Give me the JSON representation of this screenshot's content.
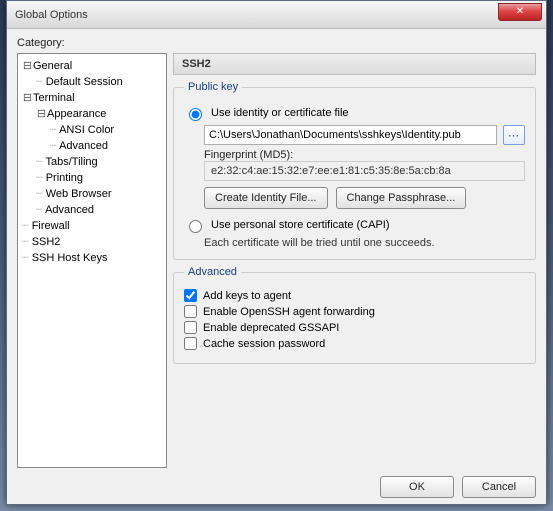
{
  "window": {
    "title": "Global Options"
  },
  "category_label": "Category:",
  "tree": {
    "general": "General",
    "default_session": "Default Session",
    "terminal": "Terminal",
    "appearance": "Appearance",
    "ansi_color": "ANSI Color",
    "advanced_appearance": "Advanced",
    "tabs_tiling": "Tabs/Tiling",
    "printing": "Printing",
    "web_browser": "Web Browser",
    "advanced_terminal": "Advanced",
    "firewall": "Firewall",
    "ssh2": "SSH2",
    "ssh_host_keys": "SSH Host Keys"
  },
  "panel": {
    "heading": "SSH2",
    "public_key": {
      "legend": "Public key",
      "use_identity_label": "Use identity or certificate file",
      "identity_path": "C:\\Users\\Jonathan\\Documents\\sshkeys\\Identity.pub",
      "fingerprint_label": "Fingerprint (MD5):",
      "fingerprint_value": "e2:32:c4:ae:15:32:e7:ee:e1:81:c5:35:8e:5a:cb:8a",
      "create_identity_btn": "Create Identity File...",
      "change_passphrase_btn": "Change Passphrase...",
      "use_capi_label": "Use personal store certificate (CAPI)",
      "capi_note": "Each certificate will be tried until one succeeds."
    },
    "advanced": {
      "legend": "Advanced",
      "add_keys": "Add keys to agent",
      "openssh_fwd": "Enable OpenSSH agent forwarding",
      "gssapi": "Enable deprecated GSSAPI",
      "cache_pw": "Cache session password"
    }
  },
  "footer": {
    "ok": "OK",
    "cancel": "Cancel"
  }
}
